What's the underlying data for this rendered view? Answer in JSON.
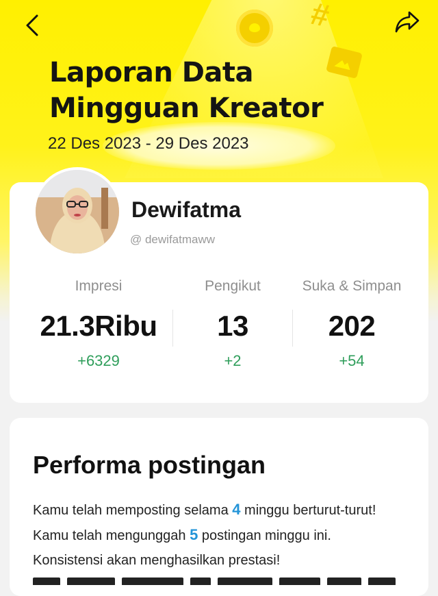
{
  "header": {
    "title": "Laporan Data Mingguan Kreator",
    "date_range": "22 Des 2023 - 29 Des 2023",
    "back_icon": "chevron-left-icon",
    "share_icon": "share-icon"
  },
  "profile": {
    "name": "Dewifatma",
    "handle": "@ dewifatmaww"
  },
  "stats": [
    {
      "label": "Impresi",
      "value": "21.3Ribu",
      "delta": "+6329"
    },
    {
      "label": "Pengikut",
      "value": "13",
      "delta": "+2"
    },
    {
      "label": "Suka & Simpan",
      "value": "202",
      "delta": "+54"
    }
  ],
  "performance": {
    "title": "Performa postingan",
    "text_1": "Kamu telah memposting selama ",
    "weeks": "4",
    "text_2": " minggu berturut-turut! Kamu telah mengunggah ",
    "posts": "5",
    "text_3": " postingan minggu ini. Konsistensi akan menghasilkan prestasi!"
  },
  "colors": {
    "brand_yellow": "#fff000",
    "delta_green": "#2f9e5b",
    "highlight_blue": "#2394d8"
  }
}
